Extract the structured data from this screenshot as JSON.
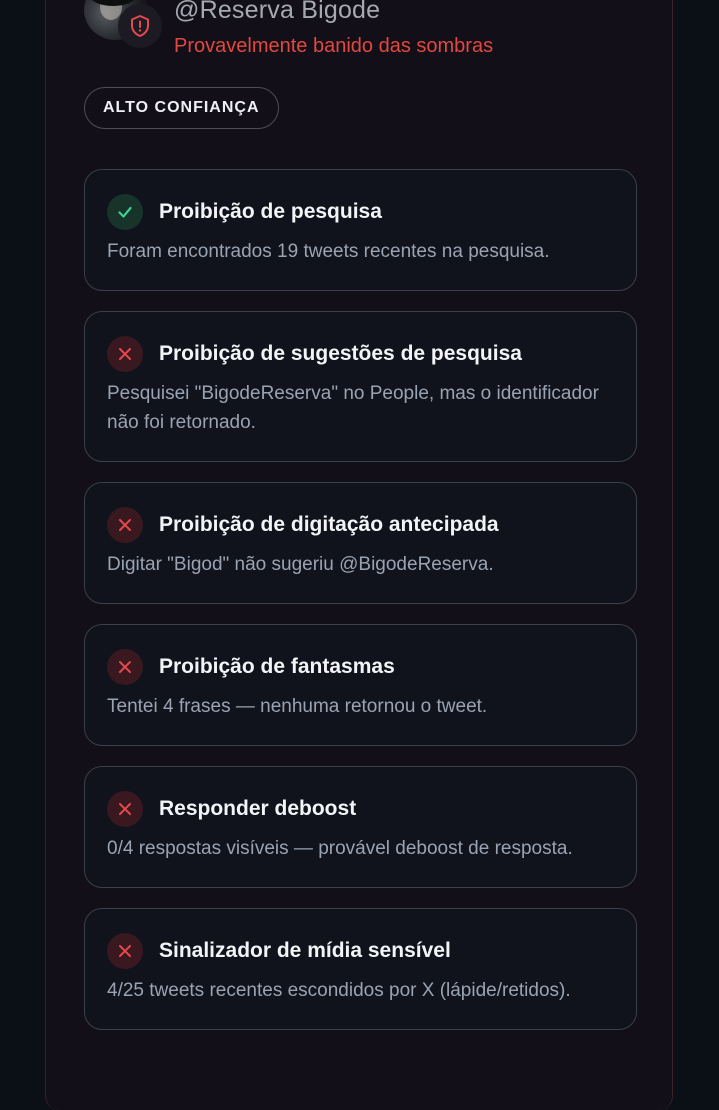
{
  "profile": {
    "handle": "@Reserva Bigode",
    "status": "Provavelmente banido das sombras",
    "avatar_icon": "user-avatar",
    "badge_icon": "shield-alert-icon"
  },
  "confidence": {
    "label": "ALTO CONFIANÇA"
  },
  "colors": {
    "pass": "#3ecf8e",
    "fail": "#e5484d",
    "status_text": "#e1483f"
  },
  "checks": [
    {
      "icon": "check-icon",
      "result": "pass",
      "title": "Proibição de pesquisa",
      "description": "Foram encontrados 19 tweets recentes na pesquisa."
    },
    {
      "icon": "x-icon",
      "result": "fail",
      "title": "Proibição de sugestões de pesquisa",
      "description": "Pesquisei \"BigodeReserva\" no People, mas o identificador não foi retornado."
    },
    {
      "icon": "x-icon",
      "result": "fail",
      "title": "Proibição de digitação antecipada",
      "description": "Digitar \"Bigod\" não sugeriu @BigodeReserva."
    },
    {
      "icon": "x-icon",
      "result": "fail",
      "title": "Proibição de fantasmas",
      "description": "Tentei 4 frases — nenhuma retornou o tweet."
    },
    {
      "icon": "x-icon",
      "result": "fail",
      "title": "Responder deboost",
      "description": "0/4 respostas visíveis — provável deboost de resposta."
    },
    {
      "icon": "x-icon",
      "result": "fail",
      "title": "Sinalizador de mídia sensível",
      "description": "4/25 tweets recentes escondidos por X (lápide/retidos)."
    }
  ]
}
